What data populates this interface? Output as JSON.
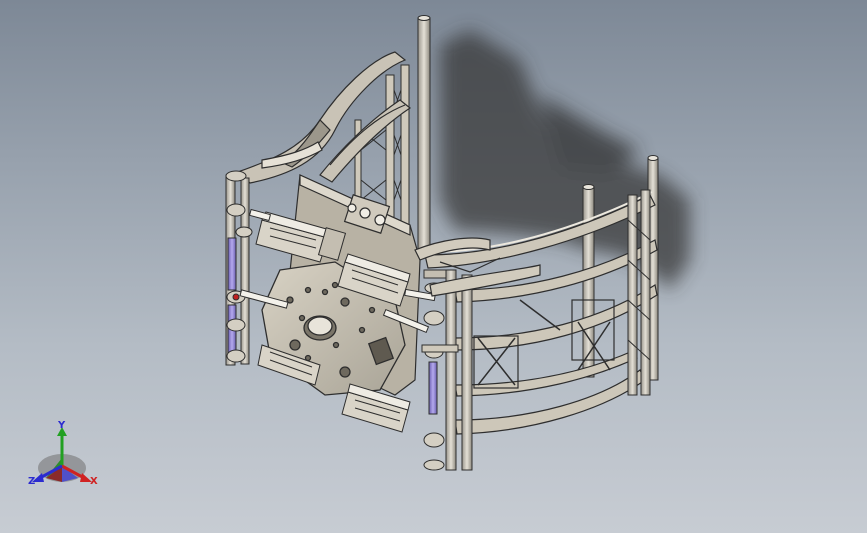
{
  "colors": {
    "background_top": "#7d8896",
    "background_bottom": "#c7ccd3",
    "frame_face": "#c9c3b6",
    "frame_edge": "#2e2e2e",
    "cylinder": "#8f83cc",
    "shadow": "#3b3b3b",
    "axis_x": "#d02222",
    "axis_y": "#22a022",
    "axis_z": "#2b2bd0"
  },
  "triad": {
    "x_label": "X",
    "y_label": "Y",
    "z_label": "Z"
  }
}
